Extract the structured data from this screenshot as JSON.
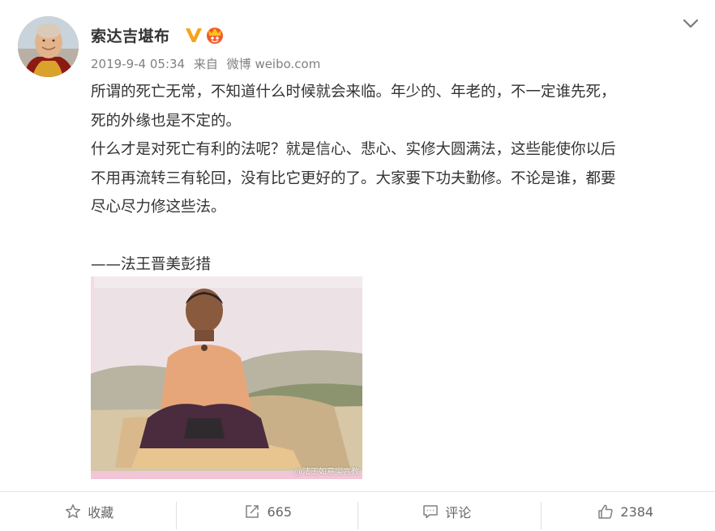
{
  "post": {
    "author": "索达吉堪布",
    "timestamp": "2019-9-4 05:34",
    "source_prefix": "来自",
    "source": "微博 weibo.com",
    "paragraphs": [
      "所谓的死亡无常，不知道什么时候就会来临。年少的、年老的，不一定谁先死，",
      "死的外缘也是不定的。",
      "什么才是对死亡有利的法呢？就是信心、悲心、实修大圆满法，这些能使你以后",
      "不用再流转三有轮回，没有比它更好的了。大家要下功夫勤修。不论是谁，都要",
      "尽心尽力修这些法。"
    ],
    "attribution": "——法王晋美彭措",
    "image_watermark": "@法王如意宝言教"
  },
  "actions": {
    "favorite_label": "收藏",
    "repost_count": "665",
    "comment_label": "评论",
    "like_count": "2384"
  },
  "colors": {
    "vip_badge": "#f7a31b",
    "member_badge": "#f15a29",
    "text_primary": "#333333",
    "text_meta": "#808080"
  },
  "icons": {
    "favorite": "star-icon",
    "repost": "repost-icon",
    "comment": "comment-icon",
    "like": "thumbs-up-icon",
    "menu": "chevron-down-icon"
  }
}
